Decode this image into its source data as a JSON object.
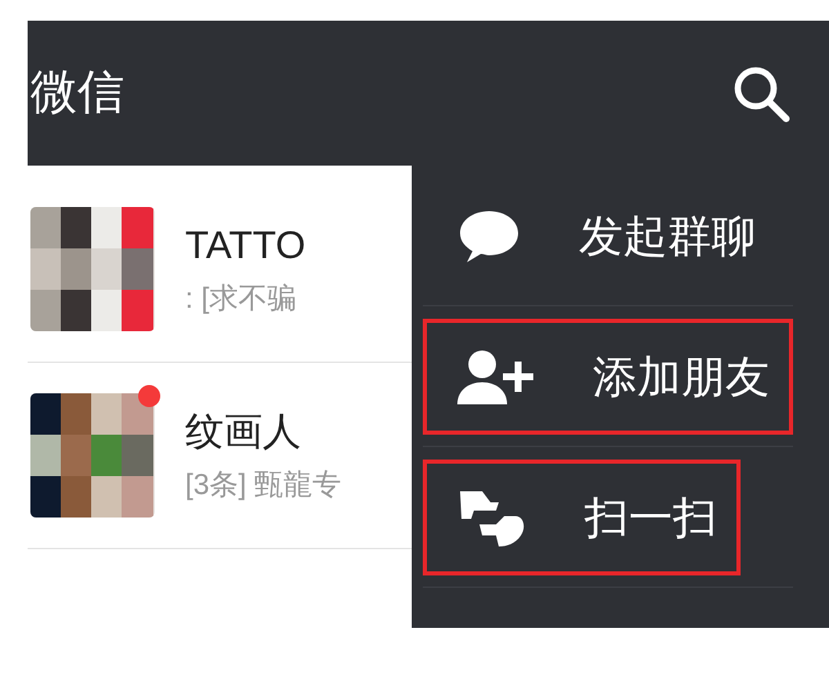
{
  "header": {
    "title": "微信"
  },
  "chats": [
    {
      "name": "TATTO",
      "preview": ": [求不骗",
      "unread": false
    },
    {
      "name": "纹画人",
      "preview": "[3条] 甄龍专",
      "unread": true
    }
  ],
  "menu": [
    {
      "kind": "chat",
      "label": "发起群聊",
      "highlighted": false
    },
    {
      "kind": "add",
      "label": "添加朋友",
      "highlighted": true
    },
    {
      "kind": "scan",
      "label": "扫一扫",
      "highlighted": true
    }
  ]
}
